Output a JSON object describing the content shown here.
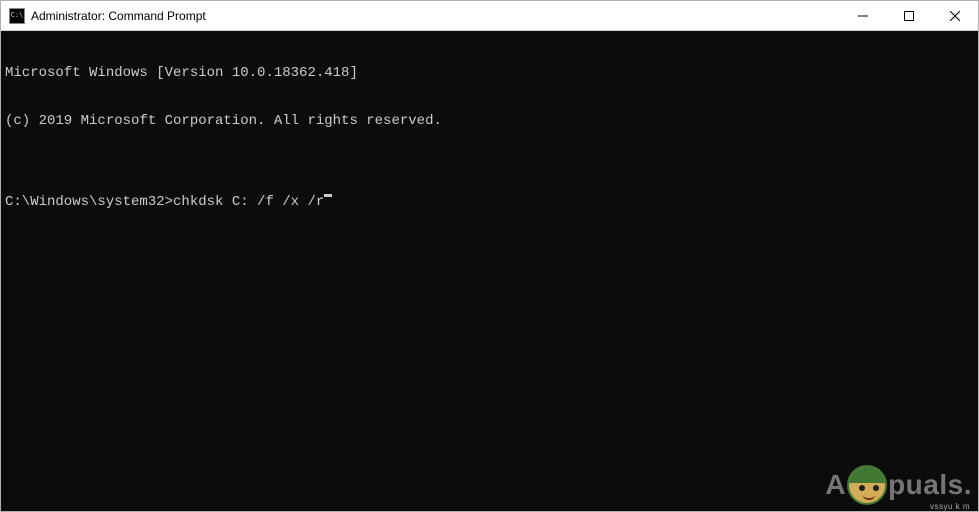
{
  "window": {
    "title": "Administrator: Command Prompt",
    "icon_label": "C:\\"
  },
  "console": {
    "line1": "Microsoft Windows [Version 10.0.18362.418]",
    "line2": "(c) 2019 Microsoft Corporation. All rights reserved.",
    "blank": "",
    "prompt": "C:\\Windows\\system32>",
    "input": "chkdsk C: /f /x /r"
  },
  "watermark": {
    "left": "A",
    "right": "puals.",
    "attr": "vssyu k m"
  }
}
